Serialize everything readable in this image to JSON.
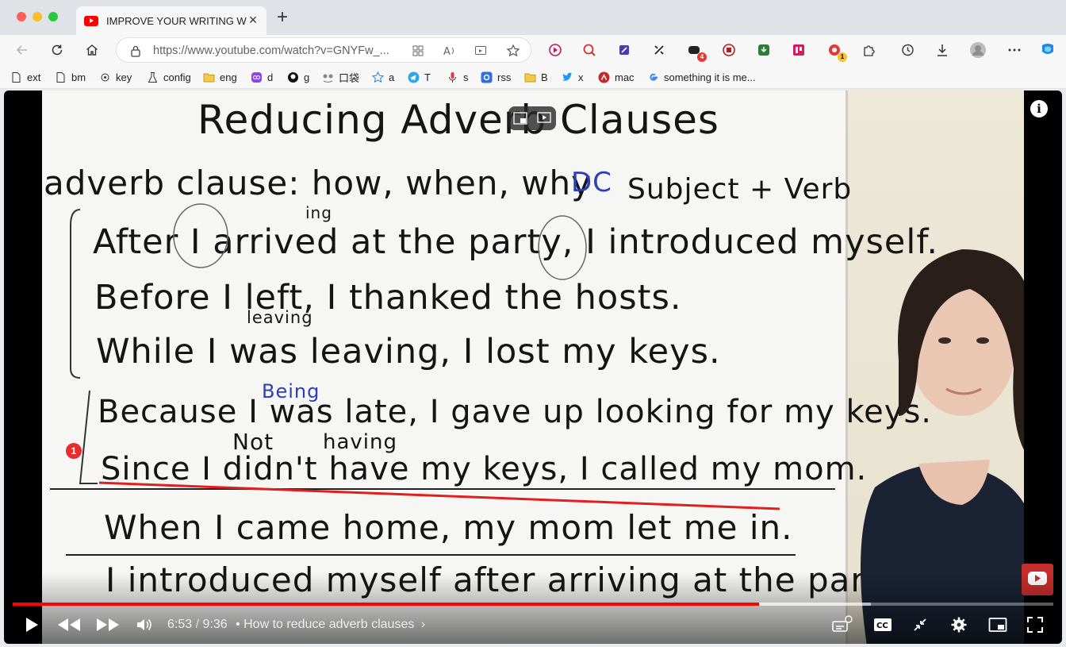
{
  "window": {
    "tab_title": "IMPROVE YOUR WRITING WITH",
    "new_tab": "+"
  },
  "toolbar": {
    "url_host": "https://www.youtube.com",
    "url_path": "/watch?v=GNYFw_..."
  },
  "bookmarks": [
    {
      "label": "ext",
      "icon": "page-icon"
    },
    {
      "label": "bm",
      "icon": "page-icon"
    },
    {
      "label": "key",
      "icon": "gear-icon"
    },
    {
      "label": "config",
      "icon": "flask-icon"
    },
    {
      "label": "eng",
      "icon": "folder-icon"
    },
    {
      "label": "d",
      "icon": "purple-app-icon"
    },
    {
      "label": "g",
      "icon": "github-icon"
    },
    {
      "label": "口袋",
      "icon": "pocket-icon"
    },
    {
      "label": "a",
      "icon": "star-icon"
    },
    {
      "label": "T",
      "icon": "telegram-icon"
    },
    {
      "label": "s",
      "icon": "mic-icon"
    },
    {
      "label": "rss",
      "icon": "rss-icon"
    },
    {
      "label": "B",
      "icon": "folder-icon"
    },
    {
      "label": "x",
      "icon": "twitter-icon"
    },
    {
      "label": "mac",
      "icon": "mac-icon"
    },
    {
      "label": "something it is me...",
      "icon": "google-icon"
    }
  ],
  "extension_badges": {
    "ext5": "4",
    "ext9": "1"
  },
  "whiteboard": {
    "title": "Reducing Adverb Clauses",
    "definition": "adverb clause: how, when, why",
    "dc_label": "DC",
    "subject_verb": "Subject + Verb",
    "line1": "After I arrived at the party, I introduced myself.",
    "line1_ing": "ing",
    "line2": "Before I left, I thanked the hosts.",
    "line2_leaving": "leaving",
    "line3": "While I was leaving, I lost my keys.",
    "line4": "Because I was late, I gave up looking for my keys.",
    "line4_being": "Being",
    "line5": "Since I didn't have my keys, I called my mom.",
    "line5_not": "Not",
    "line5_having": "having",
    "line6": "When I came home, my mom let me in.",
    "line7": "I introduced myself after arriving at the party."
  },
  "player": {
    "current_time": "6:53",
    "separator": " / ",
    "duration": "9:36",
    "chapter": "• How to reduce adverb clauses",
    "chapter_chevron": "›",
    "played_fraction": 0.717,
    "buffered_fraction": 0.825,
    "marker": "1",
    "info": "i",
    "play_color": "#ff0000"
  }
}
